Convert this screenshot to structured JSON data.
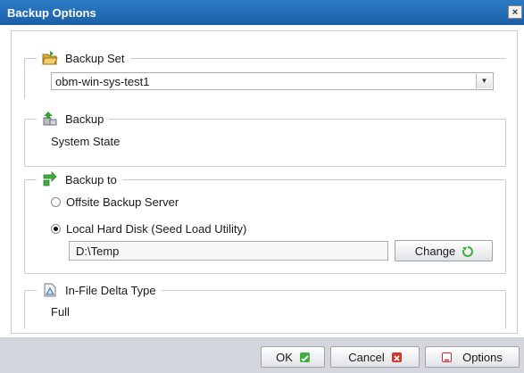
{
  "window": {
    "title": "Backup Options",
    "close_glyph": "×"
  },
  "backup_set": {
    "label": "Backup Set",
    "icon": "folder-open-icon",
    "selected": "obm-win-sys-test1"
  },
  "backup": {
    "label": "Backup",
    "icon": "backup-boxes-icon",
    "value": "System State"
  },
  "backup_to": {
    "label": "Backup to",
    "icon": "green-arrows-icon",
    "options": [
      {
        "label": "Offsite Backup Server",
        "checked": false
      },
      {
        "label": "Local Hard Disk (Seed Load Utility)",
        "checked": true
      }
    ],
    "path": "D:\\Temp",
    "change_label": "Change"
  },
  "delta": {
    "label": "In-File Delta Type",
    "icon": "delta-doc-icon",
    "value": "Full"
  },
  "buttons": {
    "ok": "OK",
    "cancel": "Cancel",
    "options": "Options"
  },
  "colors": {
    "title_bar": "#1f6bb4",
    "ok_icon": "#3fae3f",
    "cancel_icon": "#d9342b",
    "options_icon": "#cc2a2a"
  }
}
